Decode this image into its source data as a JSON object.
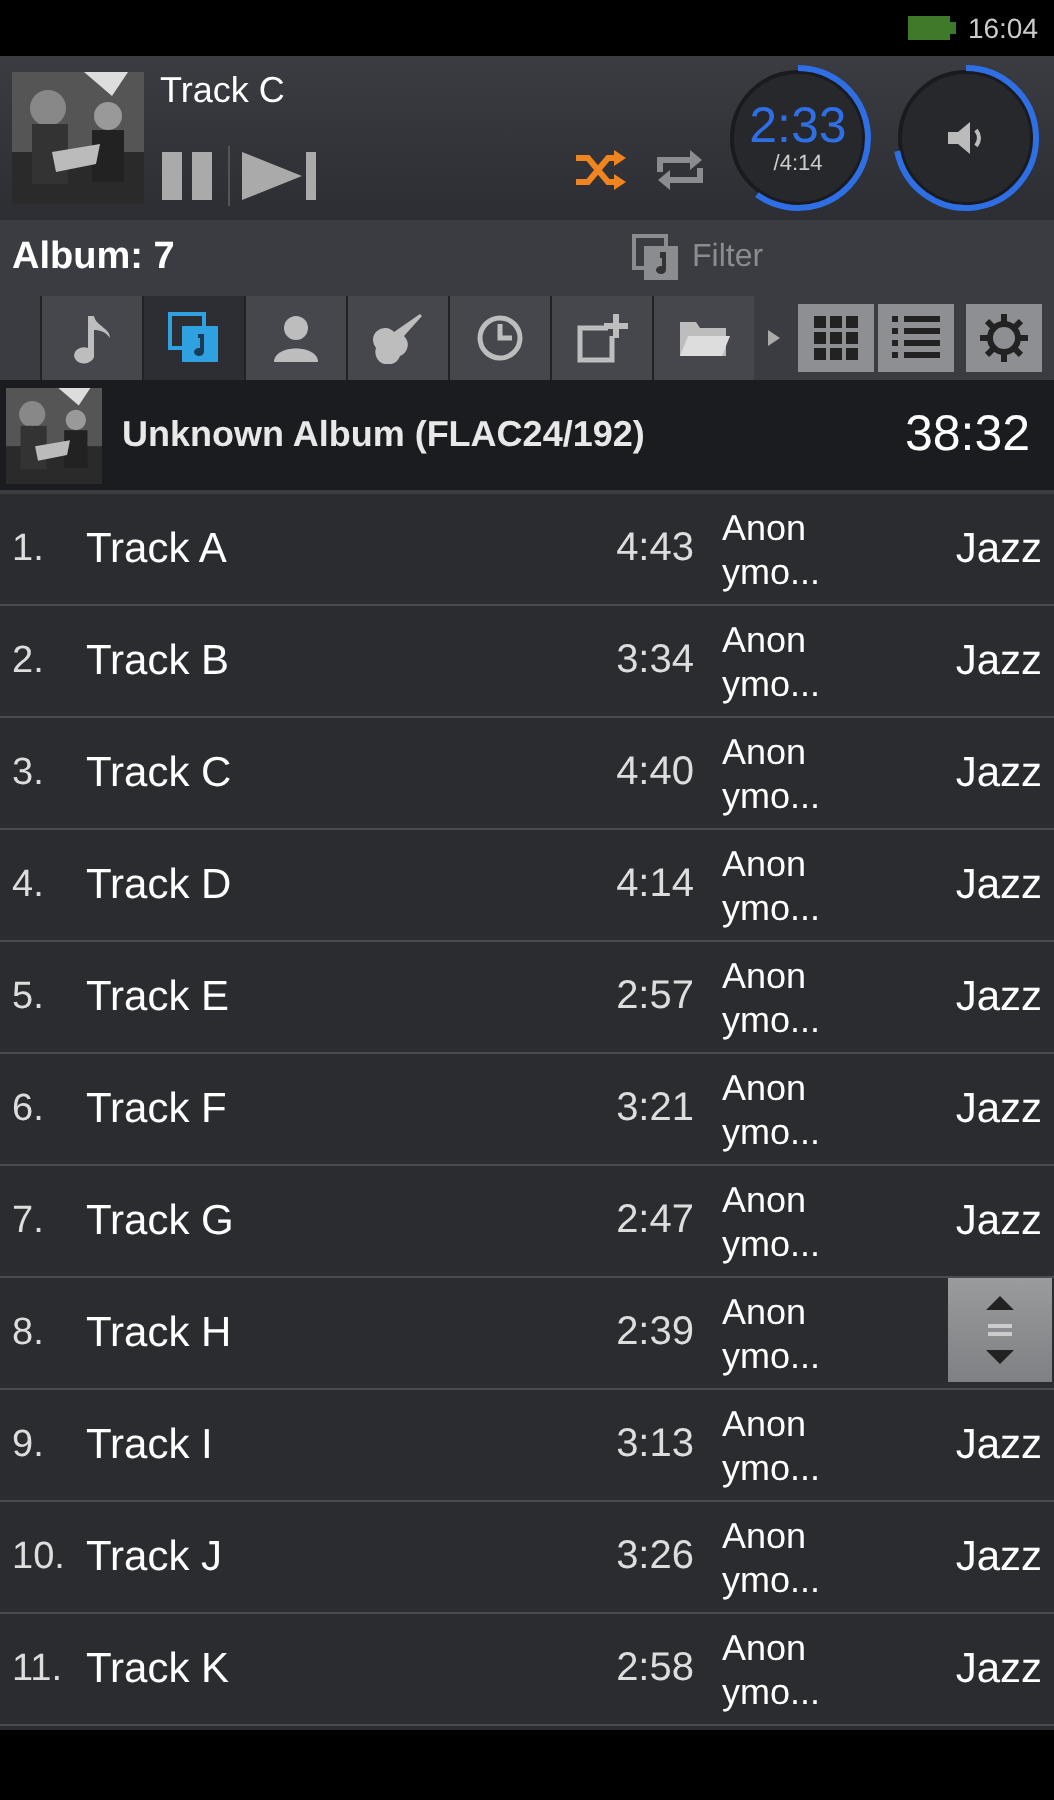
{
  "status_bar": {
    "time": "16:04"
  },
  "now_playing": {
    "title": "Track C",
    "elapsed": "2:33",
    "total": "/4:14",
    "shuffle": {
      "on": true
    },
    "repeat": {
      "on": false
    }
  },
  "album_bar": {
    "label": "Album: 7",
    "filter": "Filter"
  },
  "tabs": [
    {
      "kind": "songs",
      "selected": false
    },
    {
      "kind": "albums",
      "selected": true
    },
    {
      "kind": "artists",
      "selected": false
    },
    {
      "kind": "genres",
      "selected": false
    },
    {
      "kind": "recent",
      "selected": false
    },
    {
      "kind": "playlists",
      "selected": false
    },
    {
      "kind": "folders",
      "selected": false
    }
  ],
  "album_header": {
    "title": "Unknown Album (FLAC24/192)",
    "duration": "38:32"
  },
  "tracks": [
    {
      "number": "1.",
      "title": "Track A",
      "duration": "4:43",
      "artist": "Anonymo...",
      "genre": "Jazz"
    },
    {
      "number": "2.",
      "title": "Track B",
      "duration": "3:34",
      "artist": "Anonymo...",
      "genre": "Jazz"
    },
    {
      "number": "3.",
      "title": "Track C",
      "duration": "4:40",
      "artist": "Anonymo...",
      "genre": "Jazz"
    },
    {
      "number": "4.",
      "title": "Track D",
      "duration": "4:14",
      "artist": "Anonymo...",
      "genre": "Jazz"
    },
    {
      "number": "5.",
      "title": "Track E",
      "duration": "2:57",
      "artist": "Anonymo...",
      "genre": "Jazz"
    },
    {
      "number": "6.",
      "title": "Track F",
      "duration": "3:21",
      "artist": "Anonymo...",
      "genre": "Jazz"
    },
    {
      "number": "7.",
      "title": "Track G",
      "duration": "2:47",
      "artist": "Anonymo...",
      "genre": "Jazz"
    },
    {
      "number": "8.",
      "title": "Track H",
      "duration": "2:39",
      "artist": "Anonymo..."
    },
    {
      "number": "9.",
      "title": "Track I",
      "duration": "3:13",
      "artist": "Anonymo...",
      "genre": "Jazz"
    },
    {
      "number": "10.",
      "title": "Track J",
      "duration": "3:26",
      "artist": "Anonymo...",
      "genre": "Jazz"
    },
    {
      "number": "11.",
      "title": "Track K",
      "duration": "2:58",
      "artist": "Anonymo...",
      "genre": "Jazz"
    }
  ]
}
